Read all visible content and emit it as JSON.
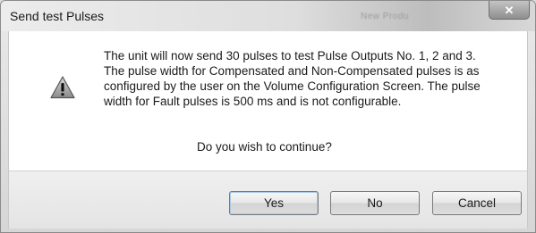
{
  "window": {
    "title": "Send test Pulses",
    "background_window_title": "New Produ",
    "close_icon": "close-icon"
  },
  "message": {
    "icon": "warning-icon",
    "lines": [
      "The unit will now send 30 pulses to test Pulse Outputs No. 1, 2 and 3.",
      "The pulse width for Compensated and Non-Compensated pulses is as",
      "configured by the user on the Volume Configuration Screen.  The pulse",
      "width for Fault pulses is 500 ms and is not configurable."
    ],
    "question": "Do you wish to continue?"
  },
  "buttons": {
    "yes": "Yes",
    "no": "No",
    "cancel": "Cancel"
  }
}
